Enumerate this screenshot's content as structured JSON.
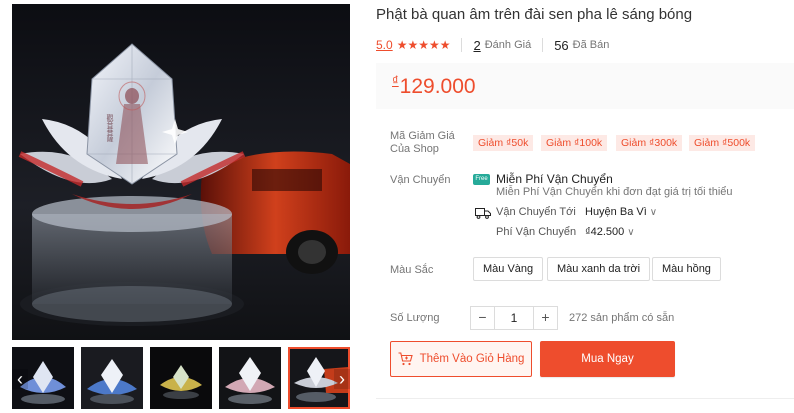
{
  "product": {
    "title": "Phật bà quan âm trên đài sen pha lê sáng bóng",
    "rating": "5.0",
    "stars": "★★★★★",
    "reviews_count": "2",
    "reviews_label": "Đánh Giá",
    "sold_count": "56",
    "sold_label": "Đã Bán",
    "currency": "₫",
    "price": "129.000"
  },
  "vouchers": {
    "label": "Mã Giảm Giá Của Shop",
    "items": [
      "Giảm ₫50k",
      "Giảm ₫100k",
      "Giảm ₫300k",
      "Giảm ₫500k"
    ]
  },
  "shipping": {
    "label": "Vận Chuyển",
    "free_icon": "Free",
    "free_title": "Miễn Phí Vận Chuyển",
    "free_sub": "Miễn Phí Vận Chuyển khi đơn đạt giá trị tối thiểu",
    "to_label": "Vận Chuyển Tới",
    "to_value": "Huyện Ba Vì",
    "fee_label": "Phí Vận Chuyển",
    "fee_value": "₫42.500"
  },
  "variants": {
    "label": "Màu Sắc",
    "options": [
      "Màu Vàng",
      "Màu xanh da trời",
      "Màu hồng"
    ]
  },
  "quantity": {
    "label": "Số Lượng",
    "minus": "−",
    "value": "1",
    "plus": "+",
    "stock": "272 sản phẩm có sẵn"
  },
  "actions": {
    "add_to_cart": "Thêm Vào Giỏ Hàng",
    "buy_now": "Mua Ngay"
  },
  "gallery": {
    "prev": "‹",
    "next": "›"
  },
  "colors": {
    "accent": "#ee4d2d",
    "voucher_bg": "#fde9e5",
    "free_ship": "#26aa99"
  }
}
